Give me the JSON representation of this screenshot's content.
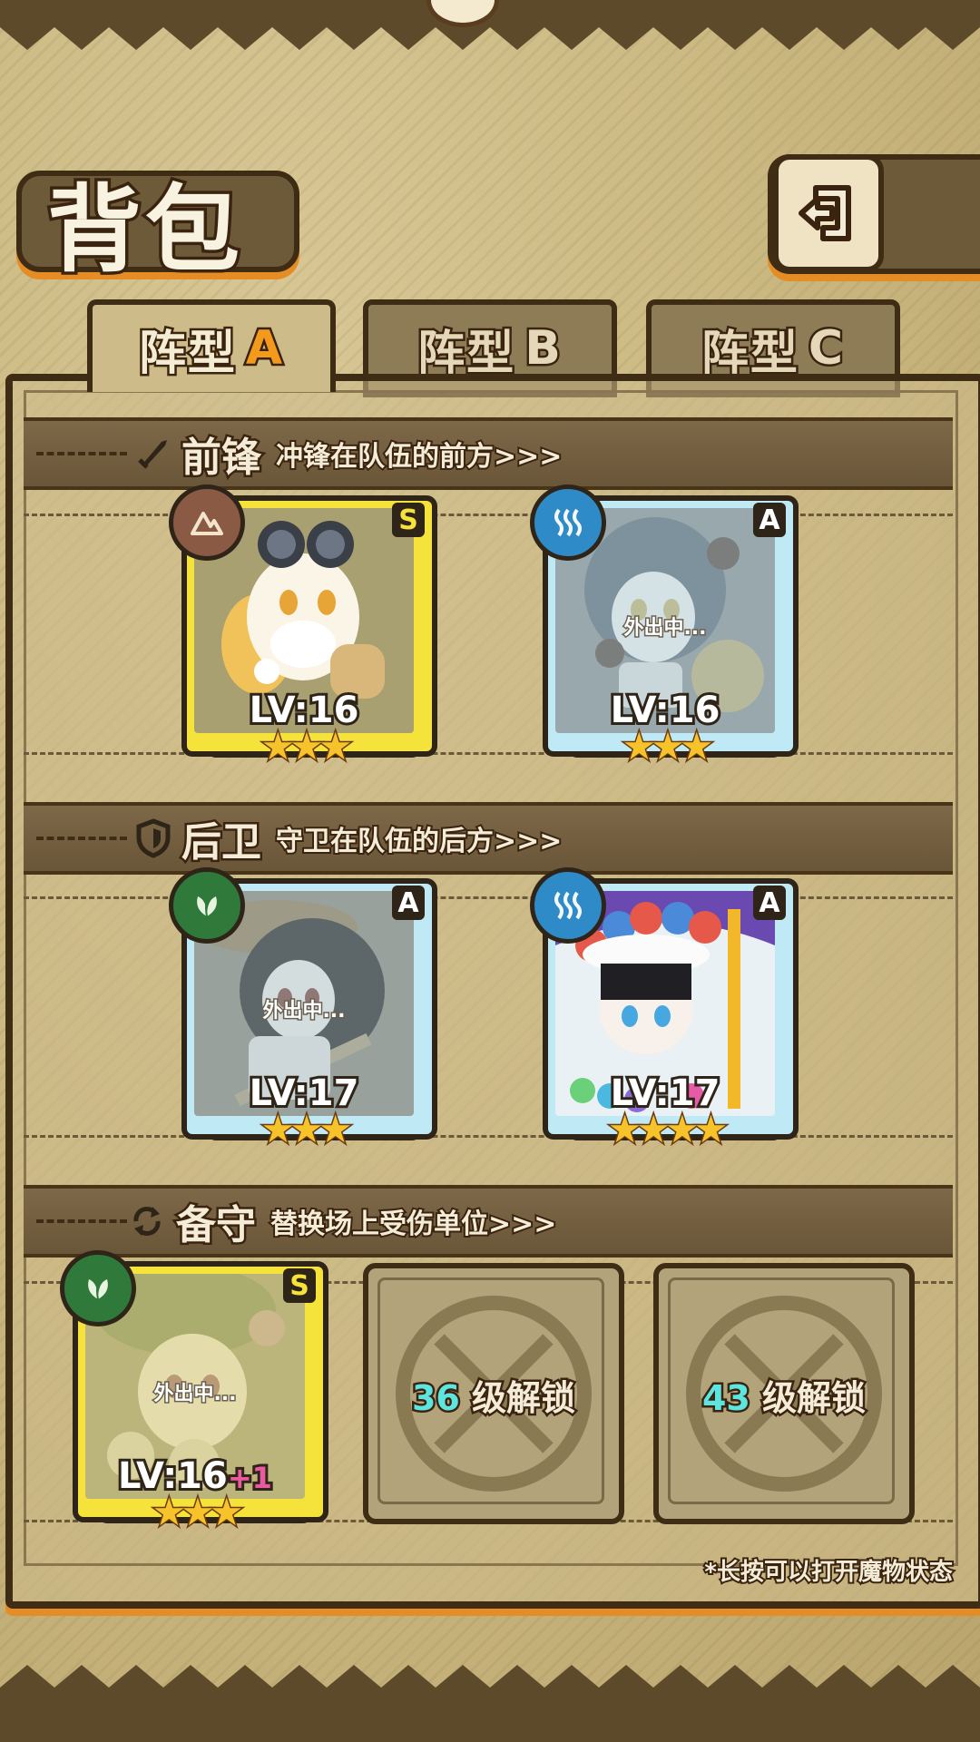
{
  "screen": {
    "title": "背包",
    "back_button_icon": "back-arrow-icon"
  },
  "tabs": [
    {
      "label": "阵型",
      "letter": "A",
      "active": true
    },
    {
      "label": "阵型",
      "letter": "B",
      "active": false
    },
    {
      "label": "阵型",
      "letter": "C",
      "active": false
    }
  ],
  "sections": {
    "vanguard": {
      "icon": "sword-icon",
      "name": "前锋",
      "desc": "冲锋在队伍的前方>>>"
    },
    "rearguard": {
      "icon": "shield-icon",
      "name": "后卫",
      "desc": "守卫在队伍的后方>>>"
    },
    "reserve": {
      "icon": "swap-icon",
      "name": "备守",
      "desc": "替换场上受伤单位>>>"
    }
  },
  "cards": {
    "v1": {
      "rank": "S",
      "element": "earth-icon",
      "level": "LV:16",
      "plus": "",
      "stars": "★★★",
      "star_count": 3,
      "status": ""
    },
    "v2": {
      "rank": "A",
      "element": "water-icon",
      "level": "LV:16",
      "plus": "",
      "stars": "★★★",
      "star_count": 3,
      "status": "外出中..."
    },
    "r1": {
      "rank": "A",
      "element": "leaf-icon",
      "level": "LV:17",
      "plus": "",
      "stars": "★★★",
      "star_count": 3,
      "status": "外出中..."
    },
    "r2": {
      "rank": "A",
      "element": "water-icon",
      "level": "LV:17",
      "plus": "",
      "stars": "★★★★",
      "star_count": 4,
      "status": ""
    },
    "b1": {
      "rank": "S",
      "element": "leaf-icon",
      "level": "LV:16",
      "plus": "+1",
      "stars": "★★★",
      "star_count": 3,
      "status": "外出中..."
    }
  },
  "locked_slots": [
    {
      "level": "36",
      "text": " 级解锁"
    },
    {
      "level": "43",
      "text": " 级解锁"
    }
  ],
  "hint": "*长按可以打开魔物状态",
  "colors": {
    "accent_orange": "#e58c24",
    "frame_dark": "#3f2c14",
    "rank_s_gold": "#f5e23a",
    "rank_a_blue": "#bfe9f5",
    "unlock_cyan": "#5de6e0"
  }
}
